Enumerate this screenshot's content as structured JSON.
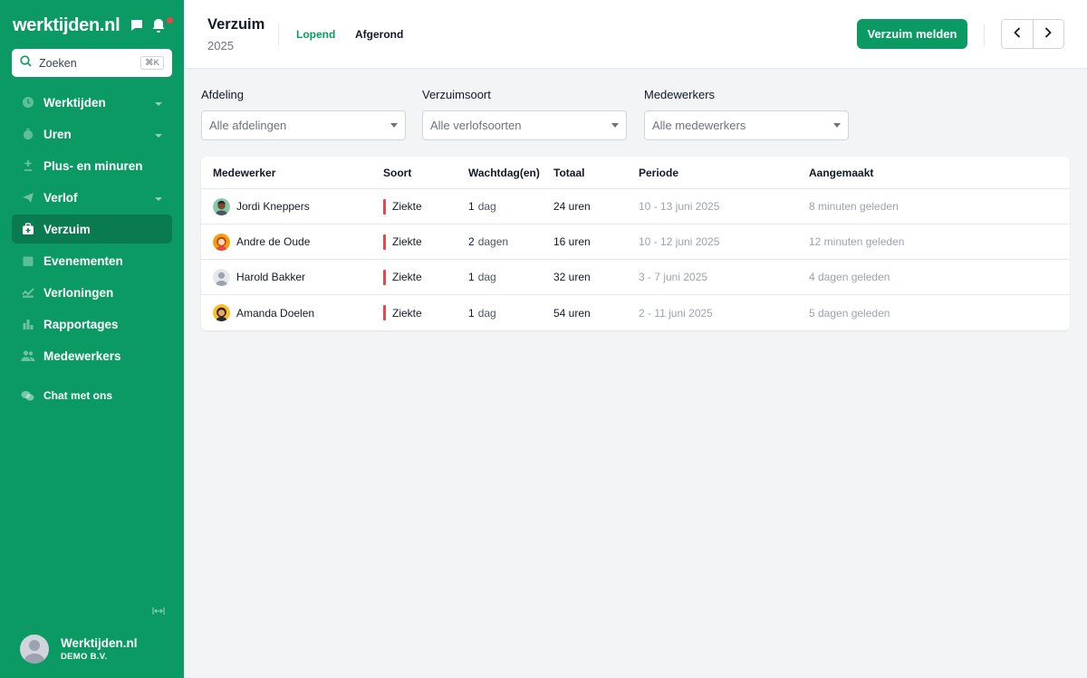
{
  "app": {
    "logo": "werktijden.nl",
    "search_placeholder": "Zoeken",
    "search_shortcut": "⌘K",
    "notification_color": "#ef4444",
    "brand_color": "#0c9a64"
  },
  "sidebar": {
    "items": [
      {
        "label": "Werktijden",
        "icon": "clock-icon",
        "has_chevron": true,
        "active": false
      },
      {
        "label": "Uren",
        "icon": "stopwatch-icon",
        "has_chevron": true,
        "active": false
      },
      {
        "label": "Plus- en minuren",
        "icon": "plus-minus-icon",
        "has_chevron": false,
        "active": false
      },
      {
        "label": "Verlof",
        "icon": "plane-icon",
        "has_chevron": true,
        "active": false
      },
      {
        "label": "Verzuim",
        "icon": "medical-bag-icon",
        "has_chevron": false,
        "active": true
      },
      {
        "label": "Evenementen",
        "icon": "calendar-icon",
        "has_chevron": false,
        "active": false
      },
      {
        "label": "Verloningen",
        "icon": "payout-icon",
        "has_chevron": false,
        "active": false
      },
      {
        "label": "Rapportages",
        "icon": "bar-chart-icon",
        "has_chevron": false,
        "active": false
      },
      {
        "label": "Medewerkers",
        "icon": "users-icon",
        "has_chevron": false,
        "active": false
      }
    ],
    "chat_label": "Chat met ons",
    "profile": {
      "name": "Werktijden.nl",
      "company": "DEMO B.V."
    }
  },
  "header": {
    "title": "Verzuim",
    "year": "2025",
    "tabs": [
      {
        "label": "Lopend",
        "active": true
      },
      {
        "label": "Afgerond",
        "active": false
      }
    ],
    "primary_button": "Verzuim melden"
  },
  "filters": [
    {
      "label": "Afdeling",
      "value": "Alle afdelingen"
    },
    {
      "label": "Verzuimsoort",
      "value": "Alle verlofsoorten"
    },
    {
      "label": "Medewerkers",
      "value": "Alle medewerkers"
    }
  ],
  "table": {
    "columns": [
      "Medewerker",
      "Soort",
      "Wachtdag(en)",
      "Totaal",
      "Periode",
      "Aangemaakt"
    ],
    "rows": [
      {
        "name": "Jordi Kneppers",
        "soort": "Ziekte",
        "wacht_num": "1",
        "wacht_unit": "dag",
        "totaal": "24 uren",
        "periode": "10 - 13 juni 2025",
        "aangemaakt": "8 minuten geleden",
        "avatar": "male-dark-avatar"
      },
      {
        "name": "Andre de Oude",
        "soort": "Ziekte",
        "wacht_num": "2",
        "wacht_unit": "dagen",
        "totaal": "16 uren",
        "periode": "10 - 12 juni 2025",
        "aangemaakt": "12 minuten geleden",
        "avatar": "female-red-avatar"
      },
      {
        "name": "Harold Bakker",
        "soort": "Ziekte",
        "wacht_num": "1",
        "wacht_unit": "dag",
        "totaal": "32 uren",
        "periode": "3 - 7 juni 2025",
        "aangemaakt": "4 dagen geleden",
        "avatar": "placeholder-avatar"
      },
      {
        "name": "Amanda Doelen",
        "soort": "Ziekte",
        "wacht_num": "1",
        "wacht_unit": "dag",
        "totaal": "54 uren",
        "periode": "2 - 11 juni 2025",
        "aangemaakt": "5 dagen geleden",
        "avatar": "female-dark-avatar"
      }
    ]
  }
}
